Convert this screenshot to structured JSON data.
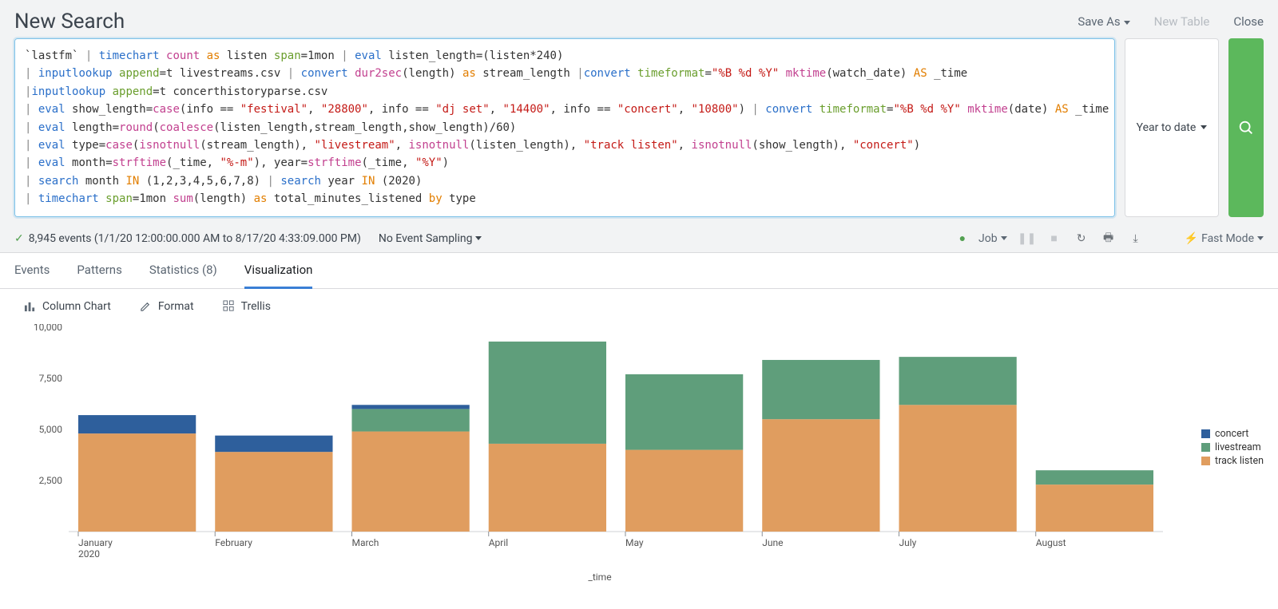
{
  "header": {
    "title": "New Search",
    "save_as": "Save As",
    "new_table": "New Table",
    "close": "Close"
  },
  "search": {
    "query_html": "`lastfm` <span class='tk-pipe'>|</span> <span class='tk-cmd'>timechart</span> <span class='tk-func'>count</span> <span class='tk-as'>as</span> listen <span class='tk-arg'>span</span>=1mon <span class='tk-pipe'>|</span> <span class='tk-cmd'>eval</span> listen_length=(listen*240)\n<span class='tk-pipe'>|</span> <span class='tk-cmd'>inputlookup</span> <span class='tk-arg'>append</span>=t livestreams.csv <span class='tk-pipe'>|</span> <span class='tk-cmd'>convert</span> <span class='tk-func'>dur2sec</span>(length) <span class='tk-as'>as</span> stream_length <span class='tk-pipe'>|</span><span class='tk-cmd'>convert</span> <span class='tk-arg'>timeformat</span>=<span class='tk-str'>\"%B %d %Y\"</span> <span class='tk-func'>mktime</span>(watch_date) <span class='tk-kw'>AS</span> _time\n<span class='tk-pipe'>|</span><span class='tk-cmd'>inputlookup</span> <span class='tk-arg'>append</span>=t concerthistoryparse.csv\n<span class='tk-pipe'>|</span> <span class='tk-cmd'>eval</span> show_length=<span class='tk-func'>case</span>(info == <span class='tk-str'>\"festival\"</span>, <span class='tk-str'>\"28800\"</span>, info == <span class='tk-str'>\"dj set\"</span>, <span class='tk-str'>\"14400\"</span>, info == <span class='tk-str'>\"concert\"</span>, <span class='tk-str'>\"10800\"</span>) <span class='tk-pipe'>|</span> <span class='tk-cmd'>convert</span> <span class='tk-arg'>timeformat</span>=<span class='tk-str'>\"%B %d %Y\"</span> <span class='tk-func'>mktime</span>(date) <span class='tk-kw'>AS</span> _time\n<span class='tk-pipe'>|</span> <span class='tk-cmd'>eval</span> length=<span class='tk-func'>round</span>(<span class='tk-func'>coalesce</span>(listen_length,stream_length,show_length)/60)\n<span class='tk-pipe'>|</span> <span class='tk-cmd'>eval</span> type=<span class='tk-func'>case</span>(<span class='tk-func'>isnotnull</span>(stream_length), <span class='tk-str'>\"livestream\"</span>, <span class='tk-func'>isnotnull</span>(listen_length), <span class='tk-str'>\"track listen\"</span>, <span class='tk-func'>isnotnull</span>(show_length), <span class='tk-str'>\"concert\"</span>)\n<span class='tk-pipe'>|</span> <span class='tk-cmd'>eval</span> month=<span class='tk-func'>strftime</span>(_time, <span class='tk-str'>\"%-m\"</span>), year=<span class='tk-func'>strftime</span>(_time, <span class='tk-str'>\"%Y\"</span>)\n<span class='tk-pipe'>|</span> <span class='tk-cmd'>search</span> month <span class='tk-kw'>IN</span> (1,2,3,4,5,6,7,8) <span class='tk-pipe'>|</span> <span class='tk-cmd'>search</span> year <span class='tk-kw'>IN</span> (2020)\n<span class='tk-pipe'>|</span> <span class='tk-cmd'>timechart</span> <span class='tk-arg'>span</span>=1mon <span class='tk-func'>sum</span>(length) <span class='tk-as'>as</span> total_minutes_listened <span class='tk-kw'>by</span> type",
    "time_range": "Year to date"
  },
  "status": {
    "events": "8,945 events (1/1/20 12:00:00.000 AM to 8/17/20 4:33:09.000 PM)",
    "sampling": "No Event Sampling",
    "job": "Job",
    "mode": "Fast Mode"
  },
  "tabs": {
    "events": "Events",
    "patterns": "Patterns",
    "statistics": "Statistics (8)",
    "visualization": "Visualization"
  },
  "viz_toolbar": {
    "chart_type": "Column Chart",
    "format": "Format",
    "trellis": "Trellis"
  },
  "legend": {
    "concert": "concert",
    "livestream": "livestream",
    "track_listen": "track listen"
  },
  "axis": {
    "xlabel": "_time",
    "yearlabel": "2020"
  },
  "chart_data": {
    "type": "bar",
    "stacked": true,
    "xlabel": "_time",
    "ylabel": "",
    "ylim": [
      0,
      10000
    ],
    "yticks": [
      2500,
      5000,
      7500,
      10000
    ],
    "categories": [
      "January",
      "February",
      "March",
      "April",
      "May",
      "June",
      "July",
      "August"
    ],
    "series": [
      {
        "name": "track listen",
        "color": "#e09d5f",
        "values": [
          4800,
          3900,
          4900,
          4300,
          4000,
          5500,
          6200,
          2300
        ]
      },
      {
        "name": "livestream",
        "color": "#5f9e7b",
        "values": [
          0,
          0,
          1100,
          5000,
          3700,
          2900,
          2350,
          700
        ]
      },
      {
        "name": "concert",
        "color": "#2e5f9c",
        "values": [
          900,
          800,
          200,
          0,
          0,
          0,
          0,
          0
        ]
      }
    ]
  }
}
